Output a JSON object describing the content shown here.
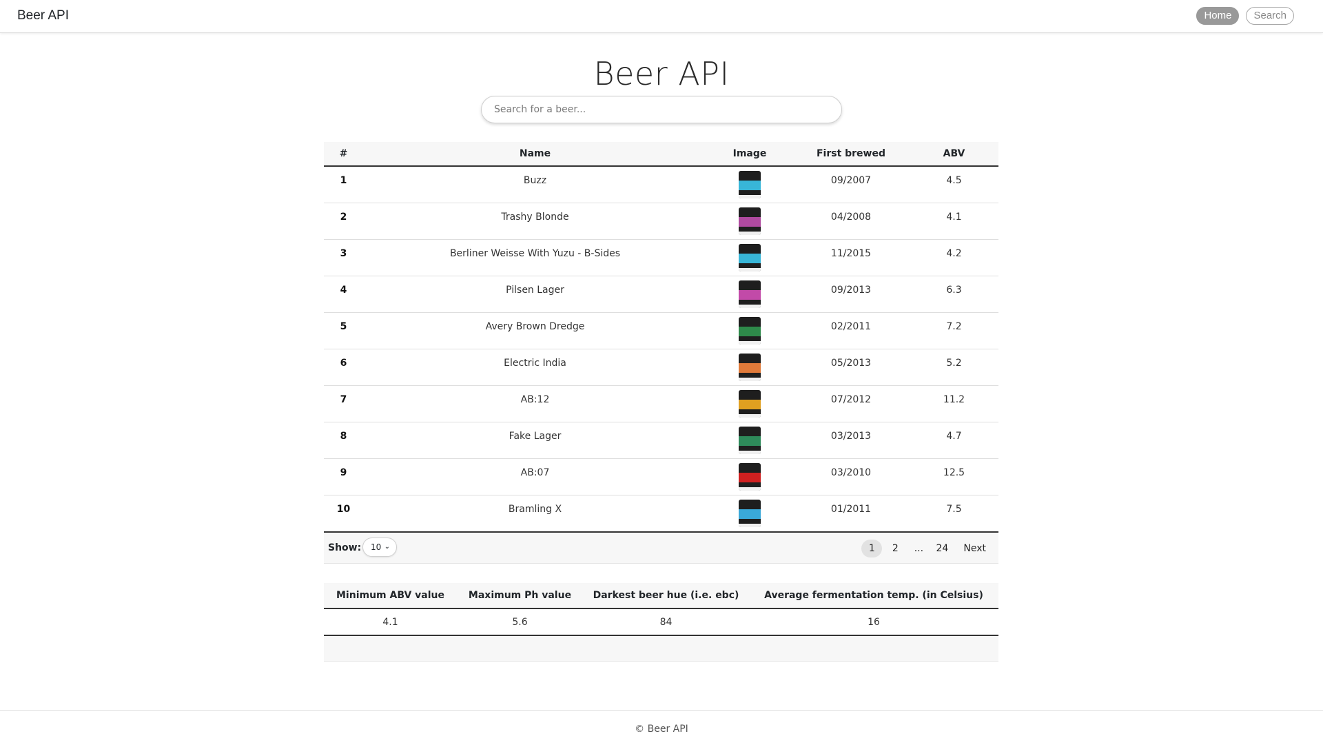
{
  "navbar": {
    "brand": "Beer API",
    "links": [
      {
        "label": "Home",
        "active": true
      },
      {
        "label": "Search",
        "active": false
      }
    ]
  },
  "page": {
    "title": "Beer API"
  },
  "search": {
    "placeholder": "Search for a beer..."
  },
  "beer_table": {
    "columns": [
      "#",
      "Name",
      "Image",
      "First brewed",
      "ABV"
    ],
    "rows": [
      {
        "num": "1",
        "name": "Buzz",
        "first_brewed": "09/2007",
        "abv": "4.5",
        "label_color": "#38b6d8"
      },
      {
        "num": "2",
        "name": "Trashy Blonde",
        "first_brewed": "04/2008",
        "abv": "4.1",
        "label_color": "#b04aa0"
      },
      {
        "num": "3",
        "name": "Berliner Weisse With Yuzu - B-Sides",
        "first_brewed": "11/2015",
        "abv": "4.2",
        "label_color": "#38b6d8"
      },
      {
        "num": "4",
        "name": "Pilsen Lager",
        "first_brewed": "09/2013",
        "abv": "6.3",
        "label_color": "#c24aa8"
      },
      {
        "num": "5",
        "name": "Avery Brown Dredge",
        "first_brewed": "02/2011",
        "abv": "7.2",
        "label_color": "#2e8a4a"
      },
      {
        "num": "6",
        "name": "Electric India",
        "first_brewed": "05/2013",
        "abv": "5.2",
        "label_color": "#e07a3a"
      },
      {
        "num": "7",
        "name": "AB:12",
        "first_brewed": "07/2012",
        "abv": "11.2",
        "label_color": "#e0a020"
      },
      {
        "num": "8",
        "name": "Fake Lager",
        "first_brewed": "03/2013",
        "abv": "4.7",
        "label_color": "#2e8a5a"
      },
      {
        "num": "9",
        "name": "AB:07",
        "first_brewed": "03/2010",
        "abv": "12.5",
        "label_color": "#d02020"
      },
      {
        "num": "10",
        "name": "Bramling X",
        "first_brewed": "01/2011",
        "abv": "7.5",
        "label_color": "#3aa8d8"
      }
    ]
  },
  "table_footer": {
    "show_label": "Show:",
    "page_size": "10",
    "pages": [
      "1",
      "2",
      "...",
      "24"
    ],
    "active_page": "1",
    "next_label": "Next"
  },
  "stats_table": {
    "columns": [
      "Minimum ABV value",
      "Maximum Ph value",
      "Darkest beer hue (i.e. ebc)",
      "Average fermentation temp. (in Celsius)"
    ],
    "values": [
      "4.1",
      "5.6",
      "84",
      "16"
    ]
  },
  "footer": {
    "copyright": "© Beer API"
  }
}
